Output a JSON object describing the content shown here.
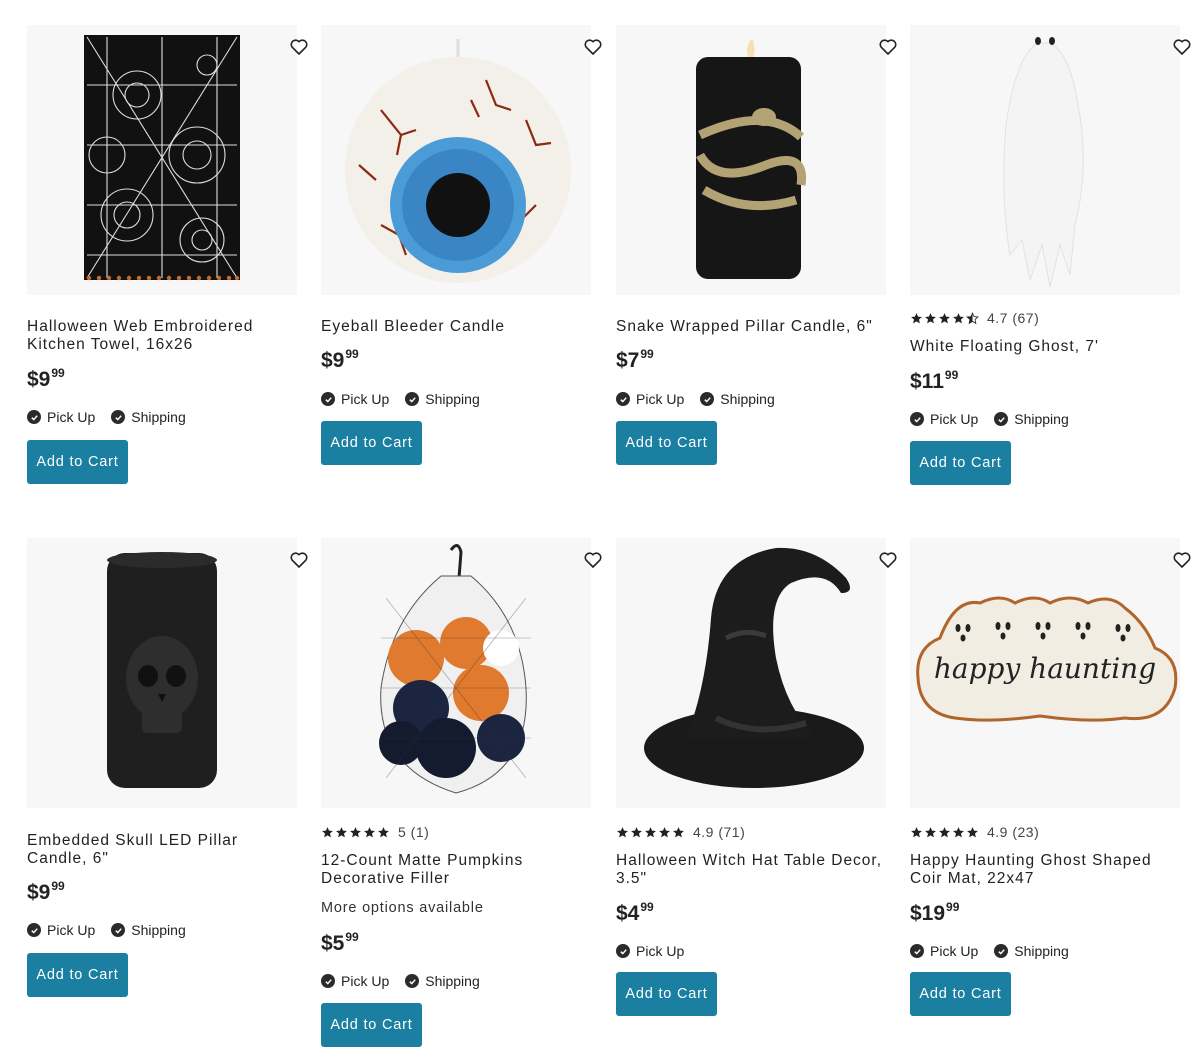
{
  "colors": {
    "accent": "#1a7fa0",
    "text": "#222222"
  },
  "products": [
    {
      "name": "Halloween Web Embroidered Kitchen Towel, 16x26",
      "price_dollars": "$9",
      "price_cents": "99",
      "fulfillment": [
        "Pick Up",
        "Shipping"
      ],
      "button": "Add to Cart",
      "image": "spiderweb-towel"
    },
    {
      "name": "Eyeball Bleeder Candle",
      "price_dollars": "$9",
      "price_cents": "99",
      "fulfillment": [
        "Pick Up",
        "Shipping"
      ],
      "button": "Add to Cart",
      "image": "eyeball-candle"
    },
    {
      "name": "Snake Wrapped Pillar Candle, 6\"",
      "price_dollars": "$7",
      "price_cents": "99",
      "fulfillment": [
        "Pick Up",
        "Shipping"
      ],
      "button": "Add to Cart",
      "image": "snake-candle"
    },
    {
      "name": "White Floating Ghost, 7'",
      "rating_text": "4.7 (67)",
      "rating": 4.7,
      "price_dollars": "$11",
      "price_cents": "99",
      "fulfillment": [
        "Pick Up",
        "Shipping"
      ],
      "button": "Add to Cart",
      "image": "floating-ghost"
    },
    {
      "name": "Embedded Skull LED Pillar Candle, 6\"",
      "price_dollars": "$9",
      "price_cents": "99",
      "fulfillment": [
        "Pick Up",
        "Shipping"
      ],
      "button": "Add to Cart",
      "image": "skull-candle"
    },
    {
      "name": "12-Count Matte Pumpkins Decorative Filler",
      "rating_text": "5 (1)",
      "rating": 5,
      "more_options": "More options available",
      "price_dollars": "$5",
      "price_cents": "99",
      "fulfillment": [
        "Pick Up",
        "Shipping"
      ],
      "button": "Add to Cart",
      "image": "pumpkins-net"
    },
    {
      "name": "Halloween Witch Hat Table Decor, 3.5\"",
      "rating_text": "4.9 (71)",
      "rating": 4.9,
      "price_dollars": "$4",
      "price_cents": "99",
      "fulfillment": [
        "Pick Up"
      ],
      "button": "Add to Cart",
      "image": "witch-hat"
    },
    {
      "name": "Happy Haunting Ghost Shaped Coir Mat, 22x47",
      "rating_text": "4.9 (23)",
      "rating": 4.9,
      "price_dollars": "$19",
      "price_cents": "99",
      "fulfillment": [
        "Pick Up",
        "Shipping"
      ],
      "button": "Add to Cart",
      "image": "ghost-mat",
      "image_text": "happy haunting"
    }
  ]
}
